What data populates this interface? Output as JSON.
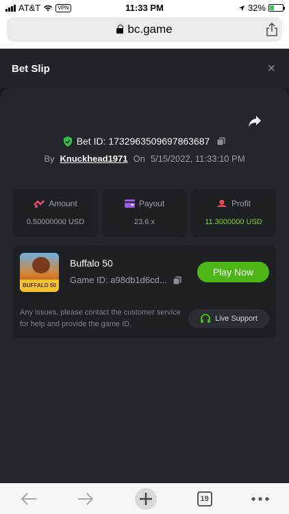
{
  "status_bar": {
    "carrier": "AT&T",
    "vpn": "VPN",
    "time": "11:33 PM",
    "battery": "32%"
  },
  "browser": {
    "url": "bc.game",
    "tabs_count": "19"
  },
  "header": {
    "title": "Bet Slip",
    "close": "×"
  },
  "bet": {
    "id_label": "Bet ID: 1732963509697863687",
    "by_label": "By",
    "user": "Knuckhead1971",
    "on_label": "On",
    "datetime": "5/15/2022, 11:33:10 PM"
  },
  "stats": {
    "amount_label": "Amount",
    "amount_value": "0.50000000 USD",
    "payout_label": "Payout",
    "payout_value": "23.6 x",
    "profit_label": "Profit",
    "profit_value": "11.3000000 USD"
  },
  "game": {
    "name": "Buffalo 50",
    "id_label": "Game ID: a98db1d6cd...",
    "thumb_text": "BUFFALO 50",
    "play_label": "Play Now",
    "notice": "Any issues, please contact the customer service for help and provide the game ID.",
    "support_label": "Live Support"
  },
  "colors": {
    "accent_green": "#4cb616",
    "profit_green": "#7bd21a",
    "bg": "#1b1c1f",
    "panel": "#25262b"
  },
  "icons": [
    "wifi-icon",
    "lock-icon",
    "share-icon",
    "close-icon",
    "share-arrow-icon",
    "shield-check-icon",
    "copy-icon",
    "amount-icon",
    "payout-icon",
    "profit-icon",
    "headset-icon",
    "back-icon",
    "forward-icon",
    "add-tab-icon",
    "more-icon"
  ]
}
